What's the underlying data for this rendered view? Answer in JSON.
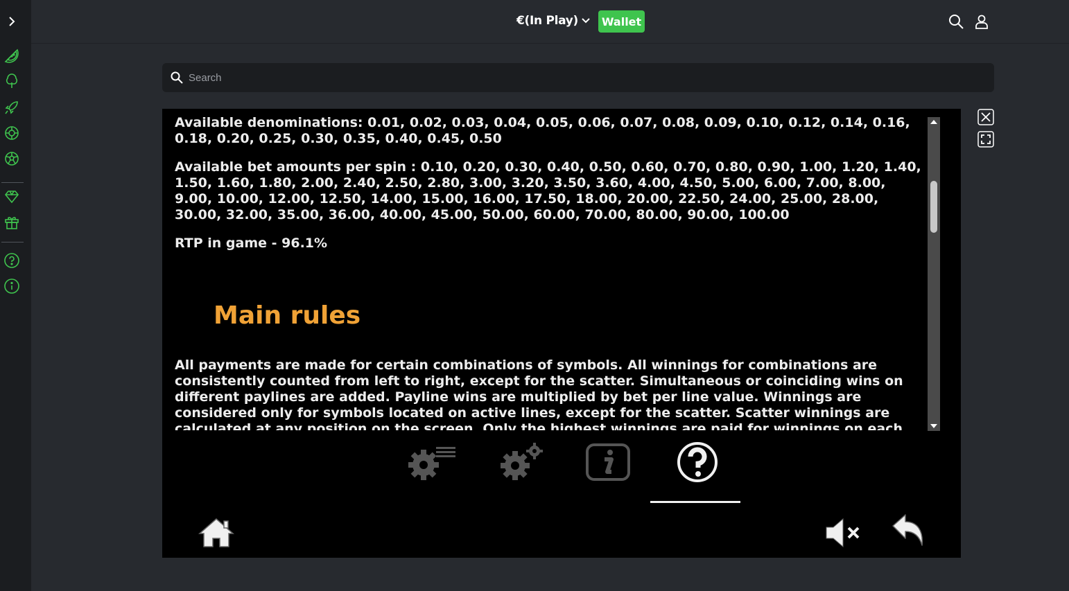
{
  "header": {
    "balance_label": "€(In Play)",
    "wallet_label": "Wallet"
  },
  "search": {
    "placeholder": "Search"
  },
  "colors": {
    "accent": "#3fc44e",
    "heading": "#f0a236"
  },
  "sidebar": {
    "icons": [
      "chevron-right-icon",
      "watermelon-icon",
      "tree-icon",
      "rocket-icon",
      "roulette-icon",
      "football-icon",
      "diamond-icon",
      "gift-icon",
      "help-icon",
      "info-icon"
    ]
  },
  "rules": {
    "denominations": "Available denominations: 0.01, 0.02, 0.03, 0.04, 0.05, 0.06, 0.07, 0.08, 0.09, 0.10, 0.12, 0.14, 0.16, 0.18, 0.20, 0.25, 0.30, 0.35, 0.40, 0.45, 0.50",
    "bet_amounts": "Available bet amounts per spin : 0.10, 0.20, 0.30, 0.40, 0.50, 0.60, 0.70, 0.80, 0.90, 1.00, 1.20, 1.40, 1.50, 1.60, 1.80, 2.00, 2.40, 2.50, 2.80, 3.00, 3.20, 3.50, 3.60, 4.00, 4.50, 5.00, 6.00, 7.00, 8.00, 9.00, 10.00, 12.00, 12.50, 14.00, 15.00, 16.00, 17.50, 18.00, 20.00, 22.50, 24.00, 25.00, 28.00, 30.00, 32.00, 35.00, 36.00, 40.00, 45.00, 50.00, 60.00, 70.00, 80.00, 90.00, 100.00",
    "rtp": "RTP in game - 96.1%",
    "heading": "Main rules",
    "main_text": "All payments are made for certain combinations of symbols. All winnings for combinations are consistently counted from left to right, except for the scatter. Simultaneous or coinciding wins on different paylines are added. Payline wins are multiplied by bet per line value. Winnings are considered only for symbols located on active lines, except for the scatter. Scatter winnings are calculated at any position on the screen. Only the highest winnings are paid for winnings on each"
  },
  "tabs": {
    "items": [
      "settings-list-icon",
      "game-settings-icon",
      "info-icon",
      "help-icon"
    ],
    "active": "help-icon"
  }
}
